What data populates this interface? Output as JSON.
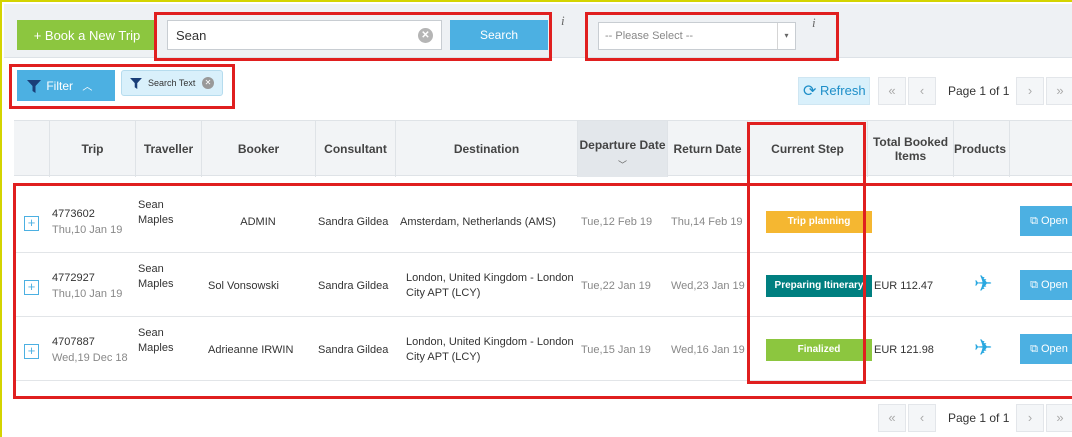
{
  "toolbar": {
    "book_label": "+ Book a New Trip",
    "search_value": "Sean",
    "search_label": "Search",
    "info_glyph": "i",
    "select_value": "-- Please Select --",
    "select_arrow": "▾"
  },
  "filter_bar": {
    "filter_label": "Filter",
    "chip_label": "Search Text",
    "refresh_label": "Refresh",
    "page_label": "Page 1 of 1"
  },
  "table": {
    "columns": [
      "Trip",
      "Traveller",
      "Booker",
      "Consultant",
      "Destination",
      "Departure Date",
      "Return Date",
      "Current Step",
      "Total Booked Items",
      "Products"
    ],
    "rows": [
      {
        "trip": "4773602",
        "created": "Thu,10 Jan 19",
        "traveller": "Sean Maples",
        "booker": "ADMIN",
        "consultant": "Sandra Gildea",
        "destination": "Amsterdam, Netherlands (AMS)",
        "departure": "Tue,12 Feb 19",
        "return": "Thu,14 Feb 19",
        "step": "Trip planning",
        "step_color": "#f5b731",
        "total": "",
        "has_product": false,
        "open_label": "Open"
      },
      {
        "trip": "4772927",
        "created": "Thu,10 Jan 19",
        "traveller": "Sean Maples",
        "booker": "Sol Vonsowski",
        "consultant": "Sandra Gildea",
        "destination": "London, United Kingdom - London City APT (LCY)",
        "departure": "Tue,22 Jan 19",
        "return": "Wed,23 Jan 19",
        "step": "Preparing Itinerary",
        "step_color": "#007f80",
        "total": "EUR 112.47",
        "has_product": true,
        "open_label": "Open"
      },
      {
        "trip": "4707887",
        "created": "Wed,19 Dec 18",
        "traveller": "Sean Maples",
        "booker": "Adrieanne IRWIN",
        "consultant": "Sandra Gildea",
        "destination": "London, United Kingdom - London City APT (LCY)",
        "departure": "Tue,15 Jan 19",
        "return": "Wed,16 Jan 19",
        "step": "Finalized",
        "step_color": "#8cc63f",
        "total": "EUR 121.98",
        "has_product": true,
        "open_label": "Open"
      }
    ]
  },
  "colors": {
    "accent": "#4cb0e2",
    "book_green": "#8cc63f",
    "highlight_red": "#e01f1f"
  },
  "icons": [
    "clear-icon",
    "info-icon",
    "filter-funnel-icon",
    "chevron-up-icon",
    "refresh-icon",
    "expand-plus-icon",
    "plane-icon",
    "open-external-icon",
    "first-page-icon",
    "previous-page-icon",
    "next-page-icon",
    "last-page-icon",
    "sort-descending-icon"
  ]
}
